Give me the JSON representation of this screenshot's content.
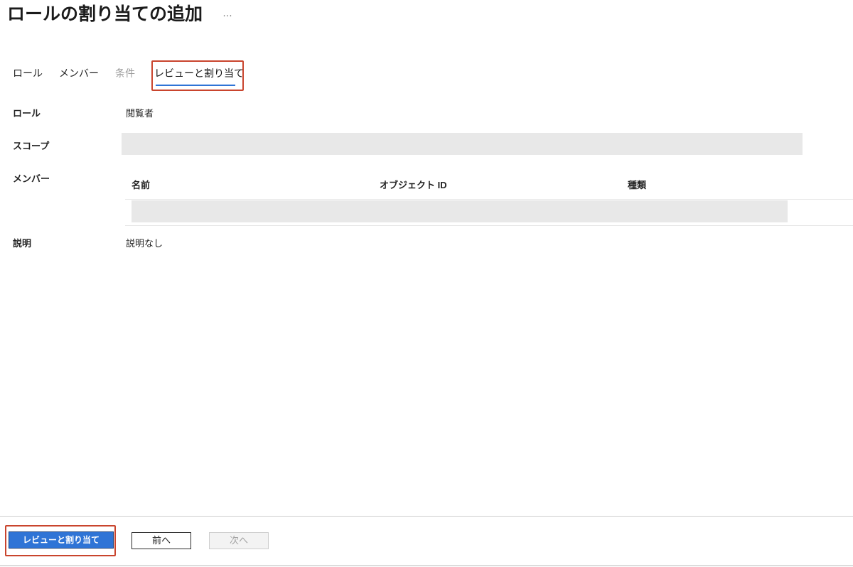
{
  "header": {
    "title": "ロールの割り当ての追加",
    "more_label": "…"
  },
  "tabs": [
    {
      "label": "ロール"
    },
    {
      "label": "メンバー"
    },
    {
      "label": "条件",
      "disabled": true
    },
    {
      "label": "レビューと割り当て",
      "selected": true
    }
  ],
  "review": {
    "role": {
      "label": "ロール",
      "value": "閲覧者"
    },
    "scope": {
      "label": "スコープ",
      "redacted": true
    },
    "members": {
      "label": "メンバー",
      "columns": [
        "名前",
        "オブジェクト ID",
        "種類"
      ],
      "rows": [
        {
          "redacted": true
        }
      ]
    },
    "description": {
      "label": "説明",
      "value": "説明なし"
    }
  },
  "footer": {
    "review_assign_label": "レビューと割り当て",
    "prev_label": "前へ",
    "next_label": "次へ",
    "next_disabled": true
  },
  "colors": {
    "accent": "#2f74d6",
    "highlight": "#c9442d",
    "redaction": "#e8e8e8",
    "disabled_text": "#9c9c9c"
  }
}
